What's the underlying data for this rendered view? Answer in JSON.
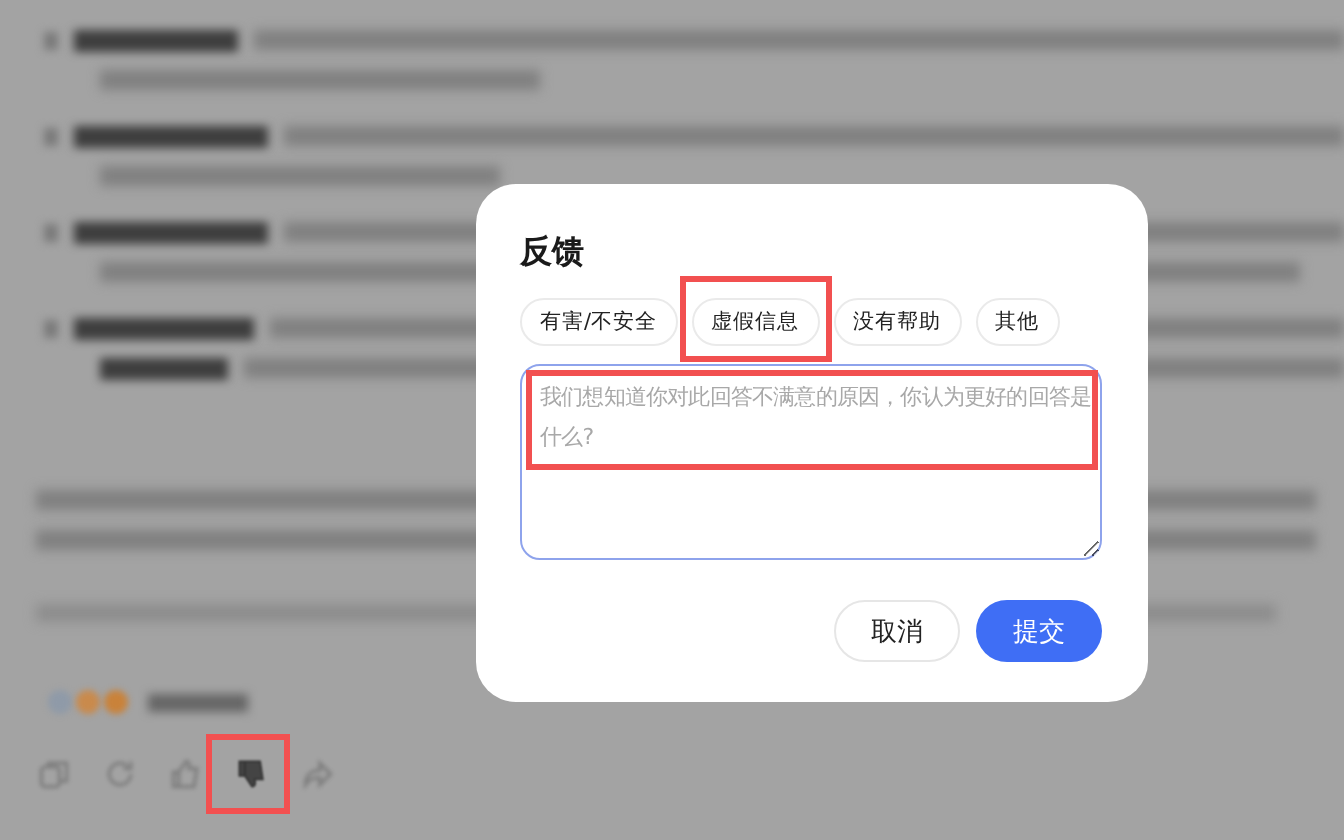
{
  "background": {
    "actions": [
      {
        "kind": "copy",
        "highlighted": false
      },
      {
        "kind": "refresh",
        "highlighted": false
      },
      {
        "kind": "like",
        "highlighted": false
      },
      {
        "kind": "dislike",
        "highlighted": true
      },
      {
        "kind": "share",
        "highlighted": false
      }
    ]
  },
  "dialog": {
    "title": "反馈",
    "chips": [
      {
        "label": "有害/不安全",
        "highlighted": false
      },
      {
        "label": "虚假信息",
        "highlighted": true
      },
      {
        "label": "没有帮助",
        "highlighted": false
      },
      {
        "label": "其他",
        "highlighted": false
      }
    ],
    "textarea": {
      "placeholder": "我们想知道你对此回答不满意的原因，你认为更好的回答是什么?",
      "highlighted": true
    },
    "buttons": [
      {
        "label": "取消",
        "kind": "secondary"
      },
      {
        "label": "提交",
        "kind": "primary"
      }
    ]
  }
}
